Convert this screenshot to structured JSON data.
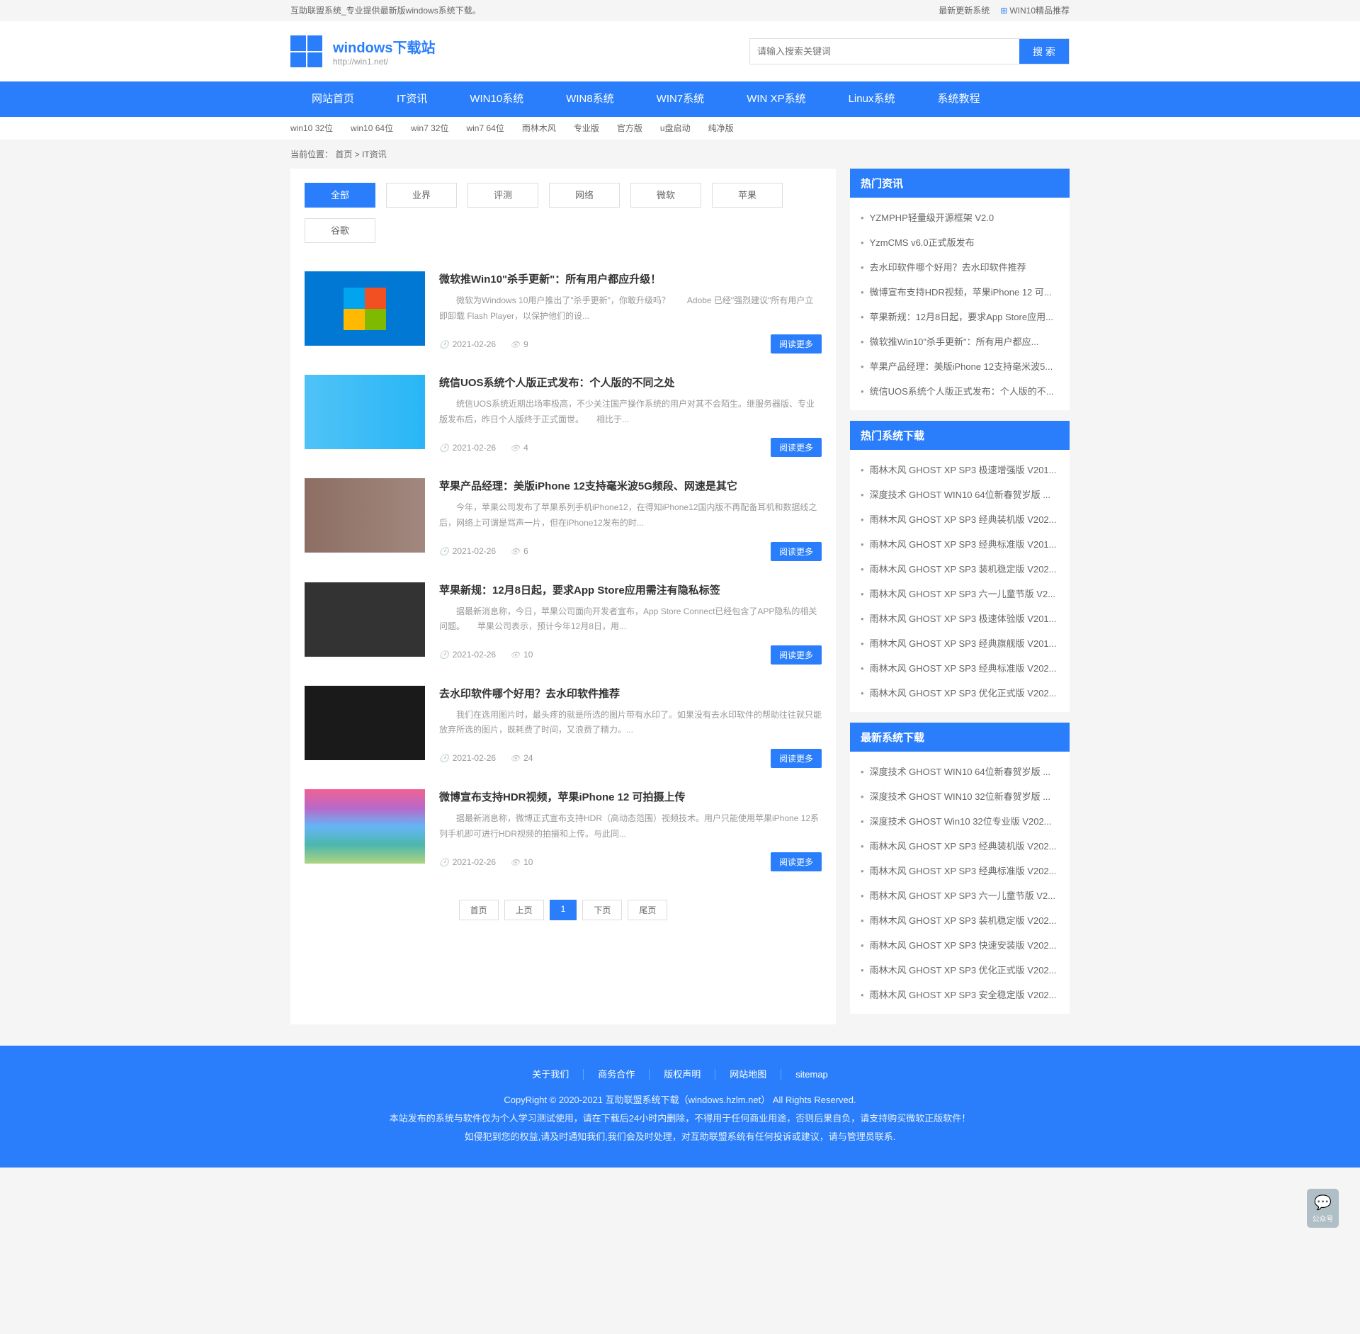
{
  "topbar": {
    "left": "互助联盟系统_专业提供最新版windows系统下载。",
    "right": [
      "最新更新系统",
      "WIN10精品推荐"
    ]
  },
  "header": {
    "title": "windows下载站",
    "subtitle": "http://win1.net/",
    "search_placeholder": "请输入搜索关键词",
    "search_btn": "搜 索"
  },
  "nav": [
    "网站首页",
    "IT资讯",
    "WIN10系统",
    "WIN8系统",
    "WIN7系统",
    "WIN XP系统",
    "Linux系统",
    "系统教程"
  ],
  "subnav": [
    "win10 32位",
    "win10 64位",
    "win7 32位",
    "win7 64位",
    "雨林木风",
    "专业版",
    "官方版",
    "u盘启动",
    "纯净版"
  ],
  "breadcrumb": {
    "label": "当前位置：",
    "home": "首页",
    "current": "IT资讯"
  },
  "filter_tabs": [
    "全部",
    "业界",
    "评测",
    "网络",
    "微软",
    "苹果",
    "谷歌"
  ],
  "articles": [
    {
      "title": "微软推Win10\"杀手更新\"：所有用户都应升级！",
      "desc": "微软为Windows 10用户推出了\"杀手更新\"，你敢升级吗？　　Adobe 已经\"强烈建议\"所有用户立即卸载 Flash Player，以保护他们的设...",
      "date": "2021-02-26",
      "views": "9",
      "btn": "阅读更多"
    },
    {
      "title": "统信UOS系统个人版正式发布：个人版的不同之处",
      "desc": "统信UOS系统近期出场率极高，不少关注国产操作系统的用户对其不会陌生。继服务器版、专业版发布后，昨日个人版终于正式面世。　　相比于...",
      "date": "2021-02-26",
      "views": "4",
      "btn": "阅读更多"
    },
    {
      "title": "苹果产品经理：美版iPhone 12支持毫米波5G频段、网速是其它",
      "desc": "今年，苹果公司发布了苹果系列手机iPhone12，在得知iPhone12国内版不再配备耳机和数据线之后，网络上可谓是骂声一片，但在iPhone12发布的时...",
      "date": "2021-02-26",
      "views": "6",
      "btn": "阅读更多"
    },
    {
      "title": "苹果新规：12月8日起，要求App Store应用需注有隐私标签",
      "desc": "据最新消息称，今日，苹果公司面向开发者宣布，App Store Connect已经包含了APP隐私的相关问题。　　苹果公司表示，预计今年12月8日，用...",
      "date": "2021-02-26",
      "views": "10",
      "btn": "阅读更多"
    },
    {
      "title": "去水印软件哪个好用？去水印软件推荐",
      "desc": "我们在选用图片时，最头疼的就是所选的图片带有水印了。如果没有去水印软件的帮助往往就只能放弃所选的图片，既耗费了时间，又浪费了精力。...",
      "date": "2021-02-26",
      "views": "24",
      "btn": "阅读更多"
    },
    {
      "title": "微博宣布支持HDR视频，苹果iPhone 12 可拍摄上传",
      "desc": "据最新消息称，微博正式宣布支持HDR（高动态范围）视频技术。用户只能使用苹果iPhone 12系列手机即可进行HDR视频的拍摄和上传。与此同...",
      "date": "2021-02-26",
      "views": "10",
      "btn": "阅读更多"
    }
  ],
  "pagination": [
    "首页",
    "上页",
    "1",
    "下页",
    "尾页"
  ],
  "sidebar": {
    "hot_news": {
      "title": "热门资讯",
      "items": [
        "YZMPHP轻量级开源框架 V2.0",
        "YzmCMS v6.0正式版发布",
        "去水印软件哪个好用？去水印软件推荐",
        "微博宣布支持HDR视频，苹果iPhone 12 可...",
        "苹果新规：12月8日起，要求App Store应用...",
        "微软推Win10\"杀手更新\"：所有用户都应...",
        "苹果产品经理：美版iPhone 12支持毫米波5...",
        "统信UOS系统个人版正式发布：个人版的不..."
      ]
    },
    "hot_downloads": {
      "title": "热门系统下载",
      "items": [
        "雨林木风 GHOST XP SP3 极速增强版 V201...",
        "深度技术 GHOST WIN10 64位新春贺岁版 ...",
        "雨林木风 GHOST XP SP3 经典装机版 V202...",
        "雨林木风 GHOST XP SP3 经典标准版 V201...",
        "雨林木风 GHOST XP SP3 装机稳定版 V202...",
        "雨林木风 GHOST XP SP3 六一儿童节版 V2...",
        "雨林木风 GHOST XP SP3 极速体验版 V201...",
        "雨林木风 GHOST XP SP3 经典旗舰版 V201...",
        "雨林木风 GHOST XP SP3 经典标准版 V202...",
        "雨林木风 GHOST XP SP3 优化正式版 V202..."
      ]
    },
    "latest_downloads": {
      "title": "最新系统下载",
      "items": [
        "深度技术 GHOST WIN10 64位新春贺岁版 ...",
        "深度技术 GHOST WIN10 32位新春贺岁版 ...",
        "深度技术 GHOST Win10 32位专业版 V202...",
        "雨林木风 GHOST XP SP3 经典装机版 V202...",
        "雨林木风 GHOST XP SP3 经典标准版 V202...",
        "雨林木风 GHOST XP SP3 六一儿童节版 V2...",
        "雨林木风 GHOST XP SP3 装机稳定版 V202...",
        "雨林木风 GHOST XP SP3 快速安装版 V202...",
        "雨林木风 GHOST XP SP3 优化正式版 V202...",
        "雨林木风 GHOST XP SP3 安全稳定版 V202..."
      ]
    }
  },
  "footer": {
    "links": [
      "关于我们",
      "商务合作",
      "版权声明",
      "网站地图",
      "sitemap"
    ],
    "copyright": "CopyRight © 2020-2021 互助联盟系统下载（windows.hzlm.net）  All Rights Reserved.",
    "notice1": "本站发布的系统与软件仅为个人学习测试使用，请在下载后24小时内删除，不得用于任何商业用途，否则后果自负，请支持购买微软正版软件！",
    "notice2": "如侵犯到您的权益,请及时通知我们,我们会及时处理，对互助联盟系统有任何投诉或建议，请与管理员联系."
  },
  "float_btn": "公众号"
}
